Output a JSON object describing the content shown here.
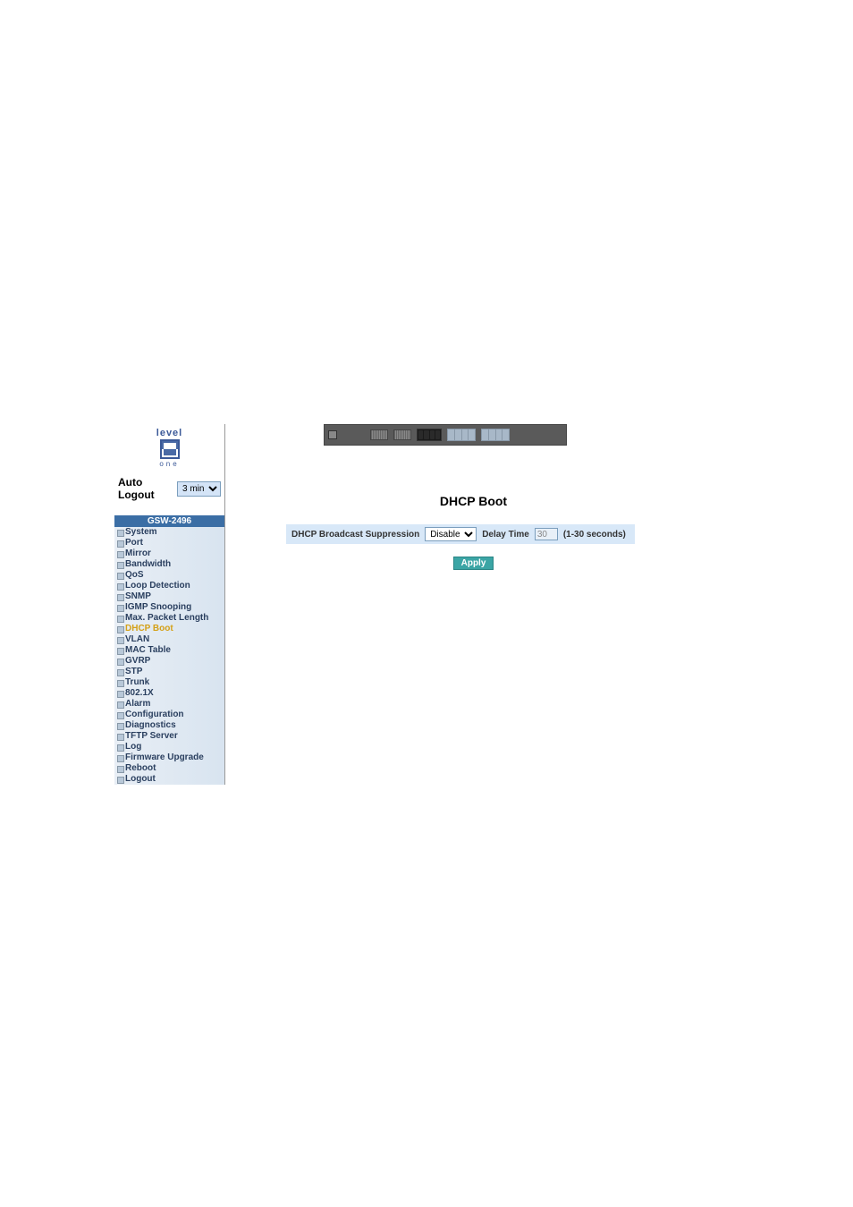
{
  "brand": {
    "top_text": "level",
    "bottom_text": "one"
  },
  "auto_logout": {
    "label": "Auto Logout",
    "selected": "3 min"
  },
  "device_model": "GSW-2496",
  "nav": {
    "items": [
      {
        "label": "System",
        "active": false
      },
      {
        "label": "Port",
        "active": false
      },
      {
        "label": "Mirror",
        "active": false
      },
      {
        "label": "Bandwidth",
        "active": false
      },
      {
        "label": "QoS",
        "active": false
      },
      {
        "label": "Loop Detection",
        "active": false
      },
      {
        "label": "SNMP",
        "active": false
      },
      {
        "label": "IGMP Snooping",
        "active": false
      },
      {
        "label": "Max. Packet Length",
        "active": false
      },
      {
        "label": "DHCP Boot",
        "active": true
      },
      {
        "label": "VLAN",
        "active": false
      },
      {
        "label": "MAC Table",
        "active": false
      },
      {
        "label": "GVRP",
        "active": false
      },
      {
        "label": "STP",
        "active": false
      },
      {
        "label": "Trunk",
        "active": false
      },
      {
        "label": "802.1X",
        "active": false
      },
      {
        "label": "Alarm",
        "active": false
      },
      {
        "label": "Configuration",
        "active": false
      },
      {
        "label": "Diagnostics",
        "active": false
      },
      {
        "label": "TFTP Server",
        "active": false
      },
      {
        "label": "Log",
        "active": false
      },
      {
        "label": "Firmware Upgrade",
        "active": false
      },
      {
        "label": "Reboot",
        "active": false
      },
      {
        "label": "Logout",
        "active": false
      }
    ]
  },
  "page": {
    "title": "DHCP Boot",
    "suppression_label": "DHCP Broadcast Suppression",
    "suppression_value": "Disable",
    "delay_label": "Delay Time",
    "delay_value": "30",
    "delay_hint": "(1-30 seconds)",
    "apply_label": "Apply"
  }
}
